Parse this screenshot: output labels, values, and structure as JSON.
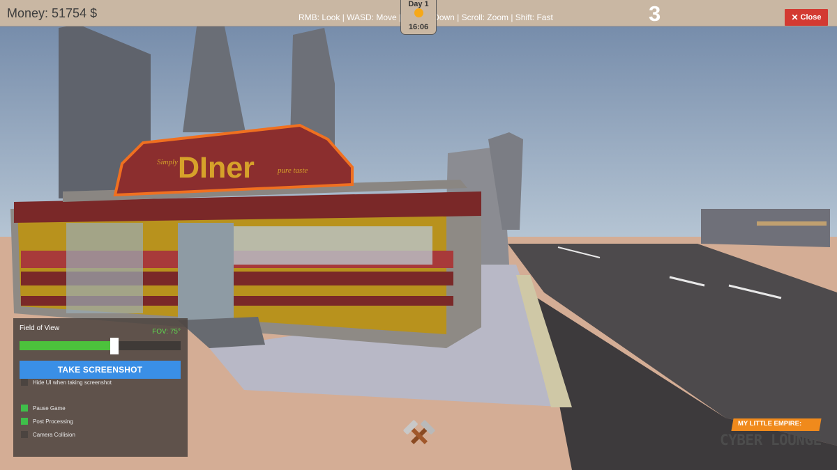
{
  "hud": {
    "money": "Money: 51754 $",
    "controls": "RMB: Look | WASD: Move | QE: Up/Down | Scroll: Zoom | Shift: Fast",
    "day": "Day 1",
    "time": "16:06",
    "counter": "3",
    "close_label": "Close",
    "close_icon": "close-icon"
  },
  "scene": {
    "sign_main": "DIner",
    "sign_left": "Simply",
    "sign_right": "pure taste"
  },
  "panel": {
    "fov_title": "Field of View",
    "fov_value_text": "FOV: 75°",
    "fov_fraction": 0.59,
    "screenshot_button": "TAKE SCREENSHOT",
    "options": [
      {
        "label": "Hide UI when taking screenshot",
        "checked": false
      },
      {
        "label": "Pause Game",
        "checked": true
      },
      {
        "label": "Post Processing",
        "checked": true
      },
      {
        "label": "Camera Collision",
        "checked": false
      }
    ]
  },
  "logo": {
    "tagline": "MY LITTLE EMPIRE:",
    "title": "CYBER LOUNGE"
  },
  "colors": {
    "hud_bar": "#c9b7a3",
    "close": "#d33a32",
    "slider_fill": "#4cc23c",
    "button": "#3a8fe6",
    "logo_orange": "#f08a1c"
  }
}
